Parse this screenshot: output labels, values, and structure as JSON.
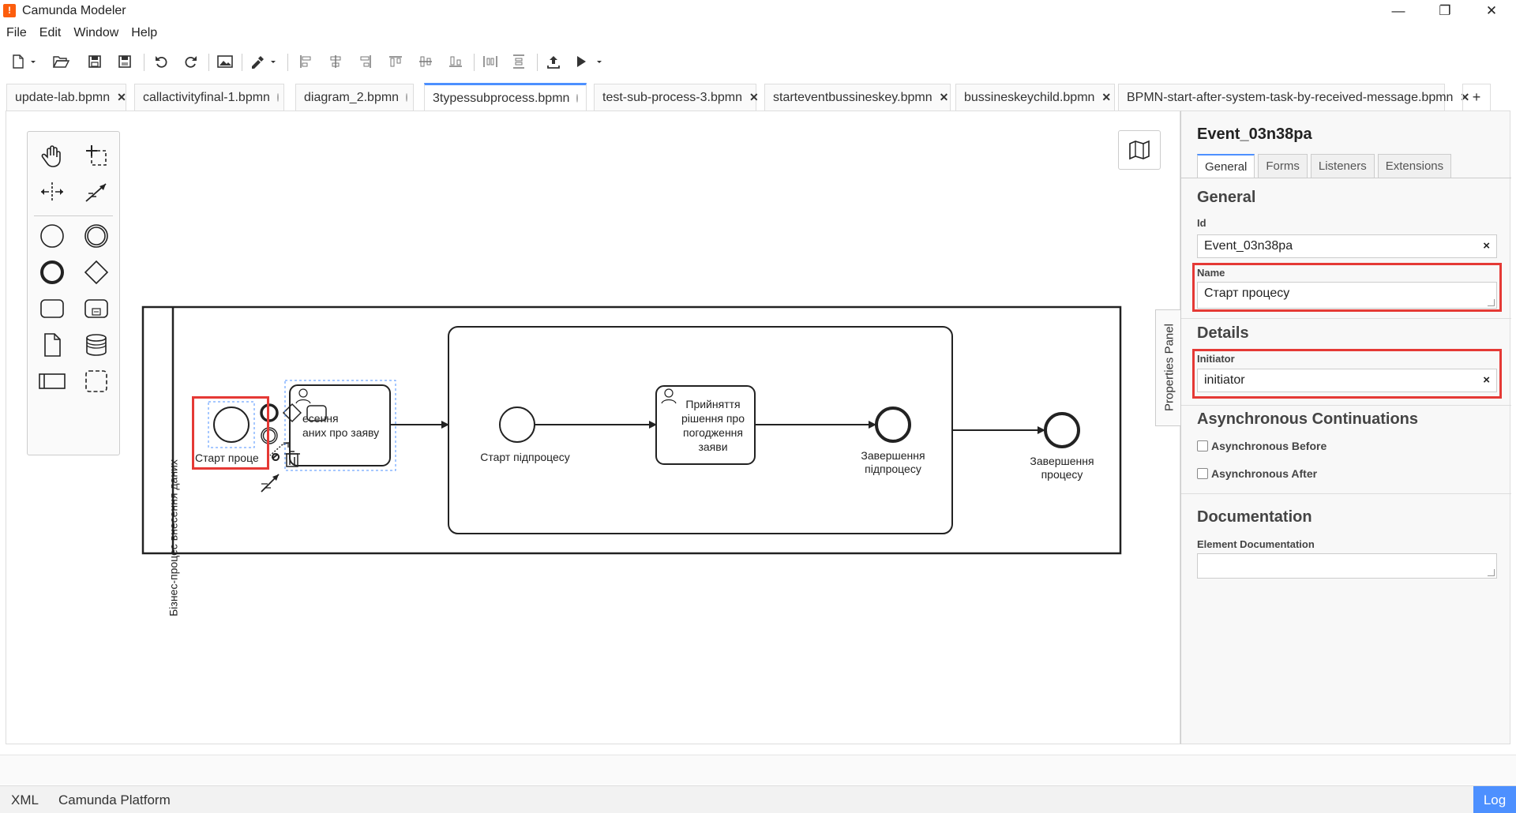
{
  "window": {
    "title": "Camunda Modeler",
    "logo_glyph": "!",
    "controls": {
      "minimize": "—",
      "restore": "❐",
      "close": "✕"
    }
  },
  "menu": [
    "File",
    "Edit",
    "Window",
    "Help"
  ],
  "toolbar": {
    "icons": [
      "new-file-icon",
      "open-icon",
      "save-icon",
      "save-all-icon",
      "undo-icon",
      "redo-icon",
      "image-export-icon",
      "color-picker-icon",
      "align-left-icon",
      "align-center-icon",
      "align-right-icon",
      "align-top-icon",
      "align-middle-icon",
      "align-bottom-icon",
      "distribute-horizontal-icon",
      "distribute-vertical-icon",
      "deploy-icon",
      "start-instance-icon"
    ]
  },
  "tabs": [
    {
      "label": "update-lab.bpmn",
      "closable": true
    },
    {
      "label": "callactivityfinal-1.bpmn",
      "closable": false
    },
    {
      "label": "diagram_2.bpmn",
      "closable": false
    },
    {
      "label": "3typessubprocess.bpmn",
      "closable": false,
      "active": true
    },
    {
      "label": "test-sub-process-3.bpmn",
      "closable": true
    },
    {
      "label": "starteventbussineskey.bpmn",
      "closable": true
    },
    {
      "label": "bussineskeychild.bpmn",
      "closable": true
    },
    {
      "label": "BPMN-start-after-system-task-by-received-message.bpmn",
      "closable": true
    }
  ],
  "tab_add": "+",
  "diagram": {
    "pool_label": "Бізнес-процес внесення даних",
    "start_event_label": "Старт проце",
    "task1_label": "есення\nаних про заяву",
    "sub_start_label": "Старт підпроцесу",
    "user_task_label": "Прийняття рішення про погодження заяви",
    "sub_end_label": "Завершення підпроцесу",
    "end_label": "Завершення процесу"
  },
  "properties_toggle": "Properties Panel",
  "properties": {
    "title": "Event_03n38pa",
    "tabs": [
      "General",
      "Forms",
      "Listeners",
      "Extensions"
    ],
    "active_tab": "General",
    "general_header": "General",
    "id_label": "Id",
    "id_value": "Event_03n38pa",
    "name_label": "Name",
    "name_value": "Старт процесу",
    "details_header": "Details",
    "initiator_label": "Initiator",
    "initiator_value": "initiator",
    "async_header": "Asynchronous Continuations",
    "async_before": "Asynchronous Before",
    "async_after": "Asynchronous After",
    "doc_header": "Documentation",
    "doc_label": "Element Documentation",
    "clear_glyph": "×"
  },
  "status": {
    "xml": "XML",
    "platform": "Camunda Platform",
    "log": "Log"
  },
  "colors": {
    "accent": "#4d90ff",
    "highlight": "#e53935",
    "logo": "#fc5d0d"
  }
}
